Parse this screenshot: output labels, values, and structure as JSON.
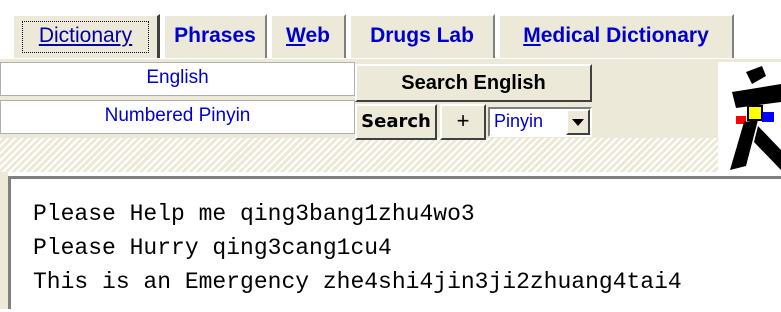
{
  "tabs": [
    {
      "label": "Dictionary",
      "active": true
    },
    {
      "label": "Phrases",
      "active": false
    },
    {
      "label_pre": "",
      "label_ul": "W",
      "label_post": "eb",
      "active": false
    },
    {
      "label": "Drugs Lab",
      "active": false
    },
    {
      "label_pre": "",
      "label_ul": "M",
      "label_post": "edical Dictionary",
      "active": false
    }
  ],
  "toolbar": {
    "english_field": "English",
    "pinyin_field": "Numbered Pinyin",
    "search_english_button": "Search English",
    "search_button": "Search",
    "plus_button": "+",
    "mode_select": {
      "value": "Pinyin",
      "options": [
        "Pinyin"
      ]
    }
  },
  "results": {
    "lines": [
      "Please Help me qing3bang1zhu4wo3",
      "Please Hurry qing3cang1cu4",
      "This is an Emergency zhe4shi4jin3ji2zhuang4tai4"
    ]
  },
  "logo": {
    "icon": "chinese-character-logo",
    "colors": [
      "#000000",
      "#ff0000",
      "#0000ff",
      "#ffff00"
    ]
  }
}
